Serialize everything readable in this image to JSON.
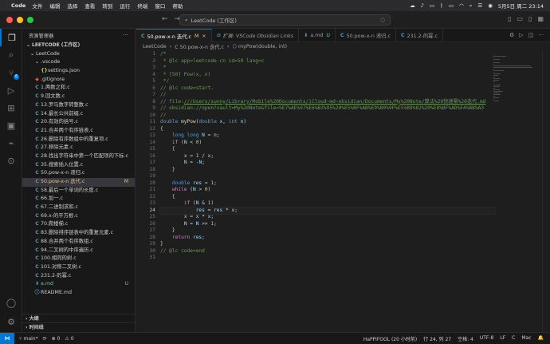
{
  "menubar": {
    "app_name": "Code",
    "menus": [
      "文件",
      "编辑",
      "选择",
      "查看",
      "转到",
      "运行",
      "终端",
      "窗口",
      "帮助"
    ],
    "datetime": "5月5日 周二  23:14"
  },
  "titlebar": {
    "search_text": "LeetCode (工作区)"
  },
  "activity": {
    "scm_badge": "6"
  },
  "sidebar": {
    "header": "资源管理器",
    "more": "···",
    "workspace": "LEETCODE (工作区)",
    "root_folder": "LeetCode",
    "vscode_folder": ".vscode",
    "settings_file": "settings.json",
    "files": [
      {
        "name": ".gitignore",
        "type": "git"
      },
      {
        "name": "1.两数之和.c",
        "type": "c"
      },
      {
        "name": "9.回文数.c",
        "type": "c"
      },
      {
        "name": "13.罗马数字转整数.c",
        "type": "c"
      },
      {
        "name": "14.最长公共前缀.c",
        "type": "c"
      },
      {
        "name": "20.有效的括号.c",
        "type": "c"
      },
      {
        "name": "21.合并两个有序链表.c",
        "type": "c"
      },
      {
        "name": "26.删除有序数组中的重复项.c",
        "type": "c"
      },
      {
        "name": "27.移除元素.c",
        "type": "c"
      },
      {
        "name": "28.找出字符串中第一个匹配项的下标.c",
        "type": "c"
      },
      {
        "name": "35.搜索插入位置.c",
        "type": "c"
      },
      {
        "name": "50.pow-x-n 递归.c",
        "type": "c"
      },
      {
        "name": "50.pow-x-n 迭代.c",
        "type": "c",
        "status": "M",
        "selected": true
      },
      {
        "name": "58.最后一个单词的长度.c",
        "type": "c"
      },
      {
        "name": "66.加一.c",
        "type": "c"
      },
      {
        "name": "67.二进制求和.c",
        "type": "c"
      },
      {
        "name": "69.x-的平方根.c",
        "type": "c"
      },
      {
        "name": "70.爬楼梯.c",
        "type": "c"
      },
      {
        "name": "83.删除排序链表中的重复元素.c",
        "type": "c"
      },
      {
        "name": "88.合并两个有序数组.c",
        "type": "c"
      },
      {
        "name": "94.二叉树的中序遍历.c",
        "type": "c"
      },
      {
        "name": "100.相同的树.c",
        "type": "c"
      },
      {
        "name": "101.对称二叉树.c",
        "type": "c"
      },
      {
        "name": "231.2-的幂.c",
        "type": "c"
      },
      {
        "name": "a.md",
        "type": "md",
        "status": "U"
      },
      {
        "name": "README.md",
        "type": "info"
      }
    ],
    "outline": "大纲",
    "timeline": "时间线"
  },
  "tabs": [
    {
      "type": "C",
      "label": "50.pow-x-n 迭代.c",
      "mark": "M",
      "active": true
    },
    {
      "type": "ext",
      "label": "扩展: VSCode Obsidian Links",
      "italic": true
    },
    {
      "type": "md",
      "label": "a.md",
      "mark": "U"
    },
    {
      "type": "C",
      "label": "50.pow-x-n 递归.c"
    },
    {
      "type": "C",
      "label": "231.2-的幂.c"
    }
  ],
  "breadcrumb": [
    "LeetCode",
    "C 50.pow-x-n 迭代.c",
    "myPow(double, int)"
  ],
  "editor": {
    "active_line": 24,
    "lines": [
      [
        [
          "c-com",
          "/*"
        ]
      ],
      [
        [
          "c-com",
          " * @lc app=leetcode.cn id=50 lang=c"
        ]
      ],
      [
        [
          "c-com",
          " *"
        ]
      ],
      [
        [
          "c-com",
          " * [50] Pow(x, n)"
        ]
      ],
      [
        [
          "c-com",
          " */"
        ]
      ],
      [
        [
          "c-com",
          "// @lc code=start."
        ]
      ],
      [
        [
          "c-com",
          "//"
        ]
      ],
      [
        [
          "c-com",
          "// file:"
        ],
        [
          "c-link",
          "///Users/sunny/Library/Mobile%20Documents/iCloud~md~obsidian/Documents/My%20Note/算法%20快速幂%20迭代.md"
        ]
      ],
      [
        [
          "c-com",
          "// obsidian://open?vault=My%20Note&file=%E7%AE%97%E6%B3%95%20%E5%BF%AB%E9%80%9F%E5%B9%82%20%E8%BF%AD%E4%BB%A3"
        ]
      ],
      [
        [
          "c-com",
          "//"
        ]
      ],
      [
        [
          "c-kw",
          "double "
        ],
        [
          "c-fn",
          "myPow"
        ],
        [
          "",
          "("
        ],
        [
          "c-kw",
          "double "
        ],
        [
          "c-var",
          "x"
        ],
        [
          "",
          ", "
        ],
        [
          "c-kw",
          "int "
        ],
        [
          "c-var",
          "n"
        ],
        [
          "",
          ")"
        ]
      ],
      [
        [
          "",
          "{"
        ]
      ],
      [
        [
          "",
          "    "
        ],
        [
          "c-kw",
          "long long "
        ],
        [
          "c-var",
          "N"
        ],
        [
          "",
          " = "
        ],
        [
          "c-var",
          "n"
        ],
        [
          "",
          ";"
        ]
      ],
      [
        [
          "",
          "    "
        ],
        [
          "c-ctl",
          "if "
        ],
        [
          "",
          "("
        ],
        [
          "c-var",
          "N"
        ],
        [
          "",
          " < "
        ],
        [
          "c-num",
          "0"
        ],
        [
          "",
          ")"
        ]
      ],
      [
        [
          "",
          "    {"
        ]
      ],
      [
        [
          "",
          "        "
        ],
        [
          "c-var",
          "x"
        ],
        [
          "",
          " = "
        ],
        [
          "c-num",
          "1"
        ],
        [
          "",
          " / "
        ],
        [
          "c-var",
          "x"
        ],
        [
          "",
          ";"
        ]
      ],
      [
        [
          "",
          "        "
        ],
        [
          "c-var",
          "N"
        ],
        [
          "",
          " = -"
        ],
        [
          "c-var",
          "N"
        ],
        [
          "",
          ";"
        ]
      ],
      [
        [
          "",
          "    }"
        ]
      ],
      [
        [
          "",
          ""
        ]
      ],
      [
        [
          "",
          "    "
        ],
        [
          "c-kw",
          "double "
        ],
        [
          "c-var",
          "res"
        ],
        [
          "",
          " = "
        ],
        [
          "c-num",
          "1"
        ],
        [
          "",
          ";"
        ]
      ],
      [
        [
          "",
          "    "
        ],
        [
          "c-ctl",
          "while "
        ],
        [
          "",
          "("
        ],
        [
          "c-var",
          "N"
        ],
        [
          "",
          " > "
        ],
        [
          "c-num",
          "0"
        ],
        [
          "",
          ")"
        ]
      ],
      [
        [
          "",
          "    {"
        ]
      ],
      [
        [
          "",
          "        "
        ],
        [
          "c-ctl",
          "if "
        ],
        [
          "",
          "("
        ],
        [
          "c-var",
          "N"
        ],
        [
          "",
          " & "
        ],
        [
          "c-num",
          "1"
        ],
        [
          "",
          ")"
        ]
      ],
      [
        [
          "",
          "            "
        ],
        [
          "c-var",
          "res"
        ],
        [
          "",
          " = "
        ],
        [
          "c-var",
          "res"
        ],
        [
          "",
          " * "
        ],
        [
          "c-var",
          "x"
        ],
        [
          "",
          ";"
        ]
      ],
      [
        [
          "",
          "        "
        ],
        [
          "c-var",
          "x"
        ],
        [
          "",
          " = "
        ],
        [
          "c-var",
          "x"
        ],
        [
          "",
          " * "
        ],
        [
          "c-var",
          "x"
        ],
        [
          "",
          ";"
        ]
      ],
      [
        [
          "",
          "        "
        ],
        [
          "c-var",
          "N"
        ],
        [
          "",
          " = "
        ],
        [
          "c-var",
          "N"
        ],
        [
          "",
          " >> "
        ],
        [
          "c-num",
          "1"
        ],
        [
          "",
          ";"
        ]
      ],
      [
        [
          "",
          "    }"
        ]
      ],
      [
        [
          "",
          "    "
        ],
        [
          "c-ctl",
          "return "
        ],
        [
          "c-var",
          "res"
        ],
        [
          "",
          ";"
        ]
      ],
      [
        [
          "",
          "}"
        ]
      ],
      [
        [
          "c-com",
          "// @lc code=end"
        ]
      ],
      [
        [
          "",
          ""
        ]
      ]
    ]
  },
  "statusbar": {
    "branch": "main*",
    "sync": "⟳",
    "errors": "⊗ 0",
    "warnings": "⚠ 0",
    "user": "HaPPiFOOL (20 小时前)",
    "position": "行 24, 列 27",
    "spaces": "空格: 4",
    "encoding": "UTF-8",
    "eol": "LF",
    "language": "C",
    "platform": "Mac"
  }
}
